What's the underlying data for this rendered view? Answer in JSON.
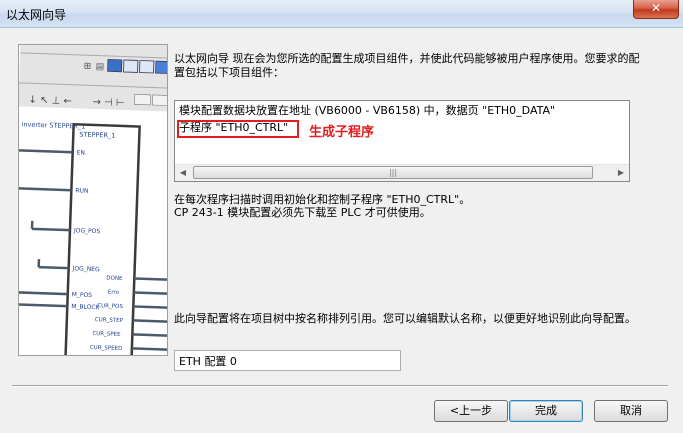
{
  "window": {
    "title": "以太网向导",
    "close_glyph": "✕"
  },
  "description": "以太网向导 现在会为您所选的配置生成项目组件，并使此代码能够被用户程序使用。您要求的配置包括以下项目组件：",
  "component_list": {
    "items": [
      "模块配置数据块放置在地址 (VB6000 - VB6158) 中，数据页 \"ETH0_DATA\"",
      "子程序 \"ETH0_CTRL\""
    ],
    "annotation": "生成子程序",
    "scroll_left_glyph": "◀",
    "scroll_right_glyph": "▶",
    "scroll_thumb_grip": "|||"
  },
  "info_lines": [
    "在每次程序扫描时调用初始化和控制子程序 \"ETH0_CTRL\"。",
    "CP 243-1 模块配置必须先下载至 PLC 才可供使用。"
  ],
  "bottom_note": "此向导配置将在项目树中按名称排列引用。您可以编辑默认名称，以便更好地识别此向导配置。",
  "config_name": "ETH 配置 0",
  "buttons": {
    "back": "<上一步",
    "finish": "完成",
    "cancel": "取消"
  },
  "illustration": {
    "block_title": "STEPPER_1",
    "header_fragment": "inverter STEPPER_1",
    "inputs": [
      "EN",
      "RUN",
      "JOG_POS",
      "JOG_NEG",
      "M_POS",
      "M_BLOCK"
    ],
    "outputs": [
      "DONE",
      "Erro",
      "CUR_POS",
      "CUR_STEP",
      "CUR_SPEE",
      "CUR_SPEED"
    ]
  },
  "colors": {
    "annotation_red": "#e01e1e",
    "title_bar": "#d4e1f1"
  }
}
